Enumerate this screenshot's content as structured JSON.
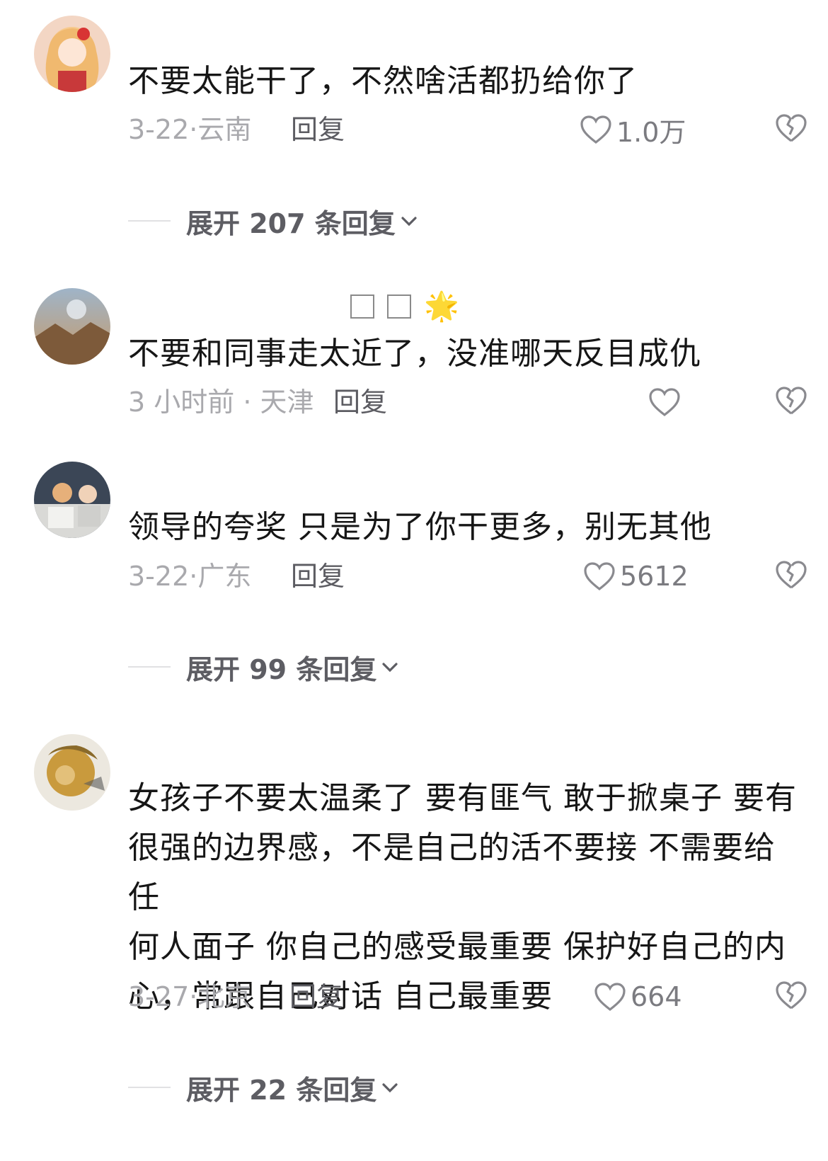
{
  "comments": [
    {
      "text": "不要太能干了，不然啥活都扔给你了",
      "meta": "3-22·云南",
      "reply": "回复",
      "likes": "1.0万",
      "expand": "展开 207 条回复"
    },
    {
      "username_emoji": "🌟",
      "text": "不要和同事走太近了，没准哪天反目成仇",
      "meta": "3 小时前 · 天津",
      "reply": "回复",
      "likes": ""
    },
    {
      "text": "领导的夸奖 只是为了你干更多，别无其他",
      "meta": "3-22·广东",
      "reply": "回复",
      "likes": "5612",
      "expand": "展开 99 条回复"
    },
    {
      "text_lines": [
        "女孩子不要太温柔了 要有匪气 敢于掀桌子 要有",
        "很强的边界感，不是自己的活不要接 不需要给任",
        "何人面子 你自己的感受最重要 保护好自己的内",
        "心，常跟自己对话 自己最重要"
      ],
      "meta": "3-27·北京",
      "reply": "回复",
      "likes": "664",
      "expand": "展开 22 条回复"
    }
  ],
  "icons": {
    "like": "heart-outline-icon",
    "dislike": "broken-heart-icon",
    "expand": "chevron-down-icon"
  },
  "colors": {
    "text": "#161616",
    "meta": "#a9a9ad",
    "action": "#5c5c62"
  }
}
